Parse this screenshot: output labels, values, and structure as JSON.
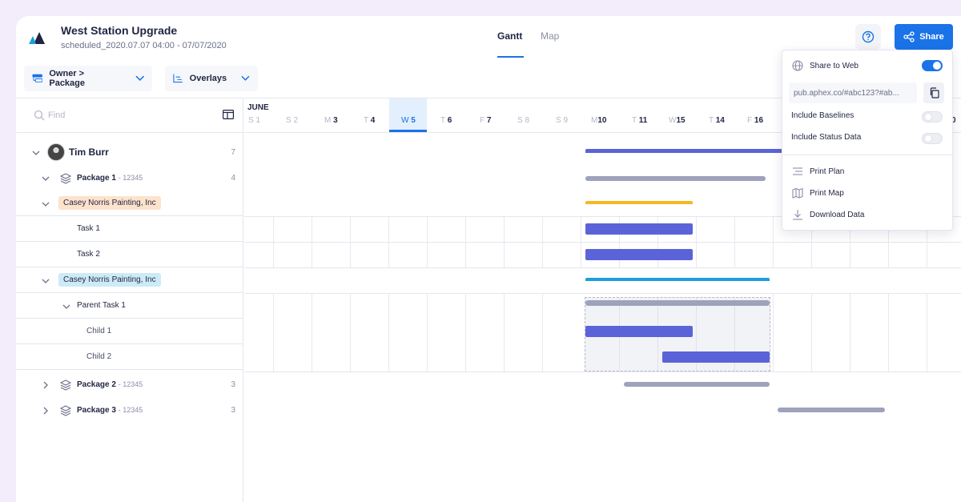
{
  "header": {
    "title": "West Station Upgrade",
    "subtitle": "scheduled_2020.07.07 04:00 - 07/07/2020",
    "tabs": [
      {
        "label": "Gantt"
      },
      {
        "label": "Map"
      }
    ],
    "share_label": "Share"
  },
  "toolbar": {
    "group_by_label": "Owner > Package",
    "overlays_label": "Overlays"
  },
  "tree": {
    "find_placeholder": "Find",
    "owner": {
      "name": "Tim Burr",
      "count": "7"
    },
    "package1": {
      "name": "Package 1",
      "id": "- 12345",
      "count": "4"
    },
    "vendor1": "Casey Norris Painting, Inc",
    "task1": "Task 1",
    "task2": "Task 2",
    "vendor2": "Casey Norris Painting, Inc",
    "parent_task": "Parent Task 1",
    "child1": "Child 1",
    "child2": "Child 2",
    "package2": {
      "name": "Package 2",
      "id": "- 12345",
      "count": "3"
    },
    "package3": {
      "name": "Package 3",
      "id": "- 12345",
      "count": "3"
    }
  },
  "timeline": {
    "month": "JUNE",
    "days": [
      {
        "dow": "S",
        "num": "1"
      },
      {
        "dow": "S",
        "num": "2"
      },
      {
        "dow": "M",
        "num": "3"
      },
      {
        "dow": "T",
        "num": "4"
      },
      {
        "dow": "W",
        "num": "5"
      },
      {
        "dow": "T",
        "num": "6"
      },
      {
        "dow": "F",
        "num": "7"
      },
      {
        "dow": "S",
        "num": "8"
      },
      {
        "dow": "S",
        "num": "9"
      },
      {
        "dow": "M",
        "num": "10"
      },
      {
        "dow": "T",
        "num": "11"
      },
      {
        "dow": "W",
        "num": "15"
      },
      {
        "dow": "T",
        "num": "14"
      },
      {
        "dow": "F",
        "num": "16"
      }
    ],
    "trailing_num": "0"
  },
  "share_menu": {
    "share_to_web": "Share to Web",
    "url": "pub.aphex.co/#abc123?#ab...",
    "include_baselines": "Include Baselines",
    "include_status": "Include Status Data",
    "print_plan": "Print Plan",
    "print_map": "Print Map",
    "download": "Download Data"
  },
  "colors": {
    "accent": "#1a73e8",
    "task_bar": "#5b63d8",
    "summary_bar": "#9ea2ba",
    "vendor1": "#f5b823",
    "vendor2": "#1a9fd9",
    "owner_bar": "#5b63d8"
  }
}
